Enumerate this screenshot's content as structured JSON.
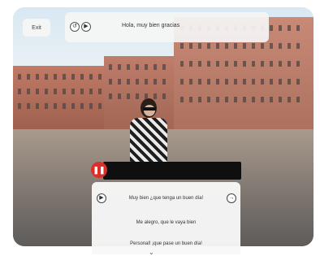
{
  "top": {
    "exit_label": "Exit",
    "phrase": "Hola, muy bien gracias"
  },
  "responses": [
    "Muy bien ¿que tenga un buen día!",
    "Me alegro, que le vaya bien",
    "Personal! ¡que pase un buen día!"
  ],
  "icons": {
    "back": "↺",
    "play": "▶",
    "pause": "❚❚",
    "option_play": "▶",
    "next": "→",
    "more": "⌄"
  }
}
